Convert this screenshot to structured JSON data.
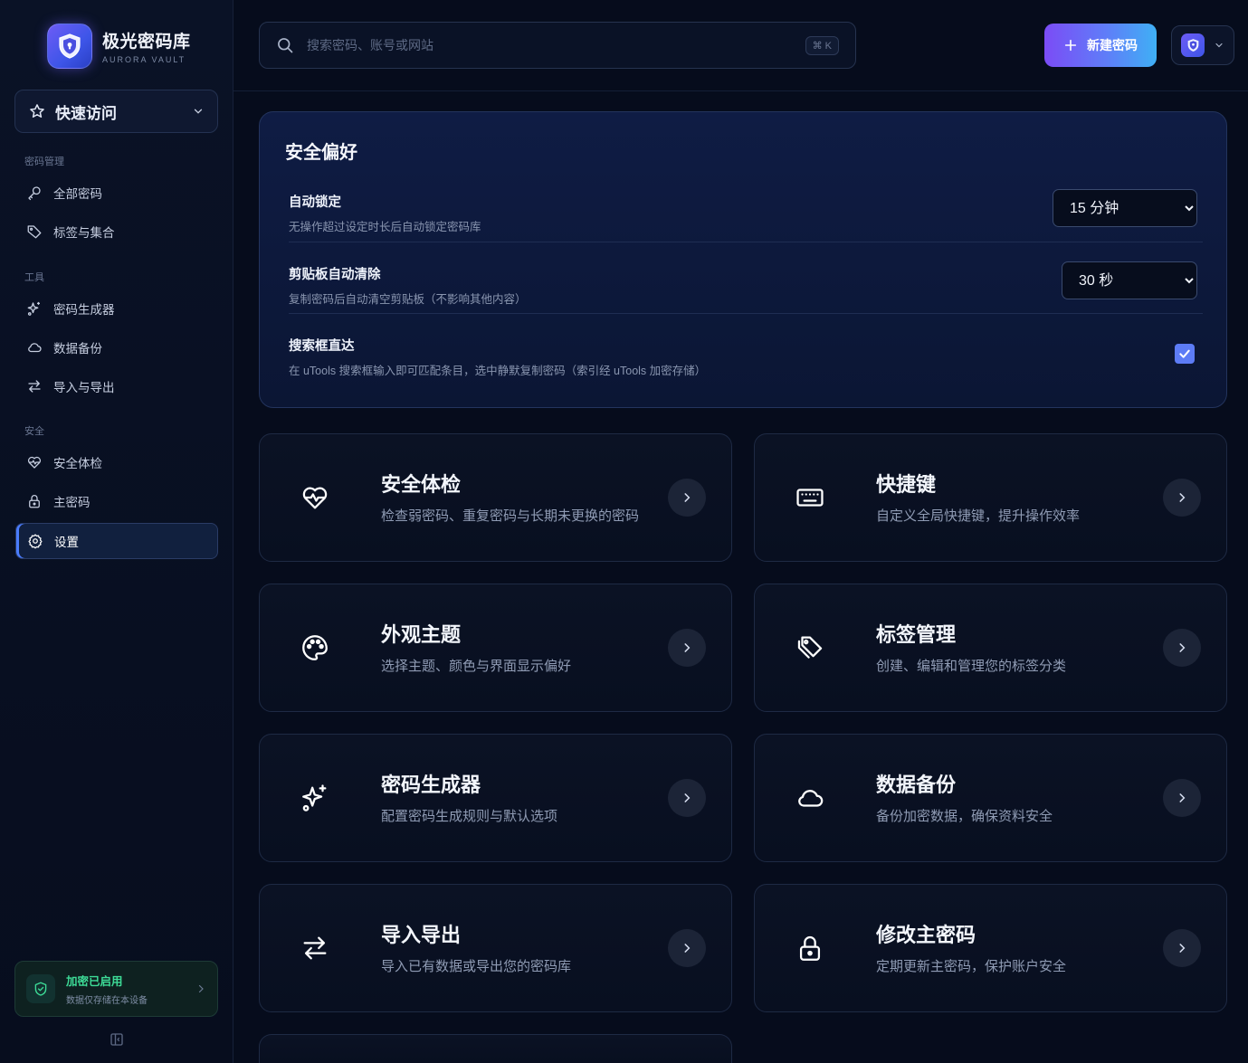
{
  "app": {
    "name": "极光密码库",
    "subtitle": "AURORA VAULT"
  },
  "quick_access": {
    "label": "快速访问"
  },
  "sidebar": {
    "sections": [
      {
        "label": "密码管理",
        "items": [
          {
            "label": "全部密码",
            "icon": "key-icon"
          },
          {
            "label": "标签与集合",
            "icon": "tag-icon"
          }
        ]
      },
      {
        "label": "工具",
        "items": [
          {
            "label": "密码生成器",
            "icon": "sparkle-icon"
          },
          {
            "label": "数据备份",
            "icon": "cloud-icon"
          },
          {
            "label": "导入与导出",
            "icon": "arrows-icon"
          }
        ]
      },
      {
        "label": "安全",
        "items": [
          {
            "label": "安全体检",
            "icon": "heart-pulse-icon"
          },
          {
            "label": "主密码",
            "icon": "lock-icon"
          },
          {
            "label": "设置",
            "icon": "gear-icon",
            "active": true
          }
        ]
      }
    ],
    "encryption": {
      "title": "加密已启用",
      "subtitle": "数据仅存储在本设备"
    }
  },
  "search": {
    "placeholder": "搜索密码、账号或网站",
    "shortcut": "⌘ K"
  },
  "new_button": {
    "label": "新建密码"
  },
  "preferences": {
    "title": "安全偏好",
    "auto_lock": {
      "title": "自动锁定",
      "desc": "无操作超过设定时长后自动锁定密码库",
      "value": "15 分钟"
    },
    "clipboard": {
      "title": "剪贴板自动清除",
      "desc": "复制密码后自动清空剪贴板（不影响其他内容）",
      "value": "30 秒"
    },
    "search_direct": {
      "title": "搜索框直达",
      "desc": "在 uTools 搜索框输入即可匹配条目，选中静默复制密码（索引经 uTools 加密存储）",
      "checked": true
    }
  },
  "cards": [
    {
      "title": "安全体检",
      "desc": "检查弱密码、重复密码与长期未更换的密码",
      "icon": "heart-pulse-icon"
    },
    {
      "title": "快捷键",
      "desc": "自定义全局快捷键，提升操作效率",
      "icon": "keyboard-icon"
    },
    {
      "title": "外观主题",
      "desc": "选择主题、颜色与界面显示偏好",
      "icon": "palette-icon"
    },
    {
      "title": "标签管理",
      "desc": "创建、编辑和管理您的标签分类",
      "icon": "tag-icon"
    },
    {
      "title": "密码生成器",
      "desc": "配置密码生成规则与默认选项",
      "icon": "sparkle-icon"
    },
    {
      "title": "数据备份",
      "desc": "备份加密数据，确保资料安全",
      "icon": "cloud-icon"
    },
    {
      "title": "导入导出",
      "desc": "导入已有数据或导出您的密码库",
      "icon": "arrows-icon"
    },
    {
      "title": "修改主密码",
      "desc": "定期更新主密码，保护账户安全",
      "icon": "lock-icon"
    }
  ],
  "colors": {
    "accent": "#5d7cf6",
    "success": "#3ddc97",
    "background": "#060c1c"
  }
}
